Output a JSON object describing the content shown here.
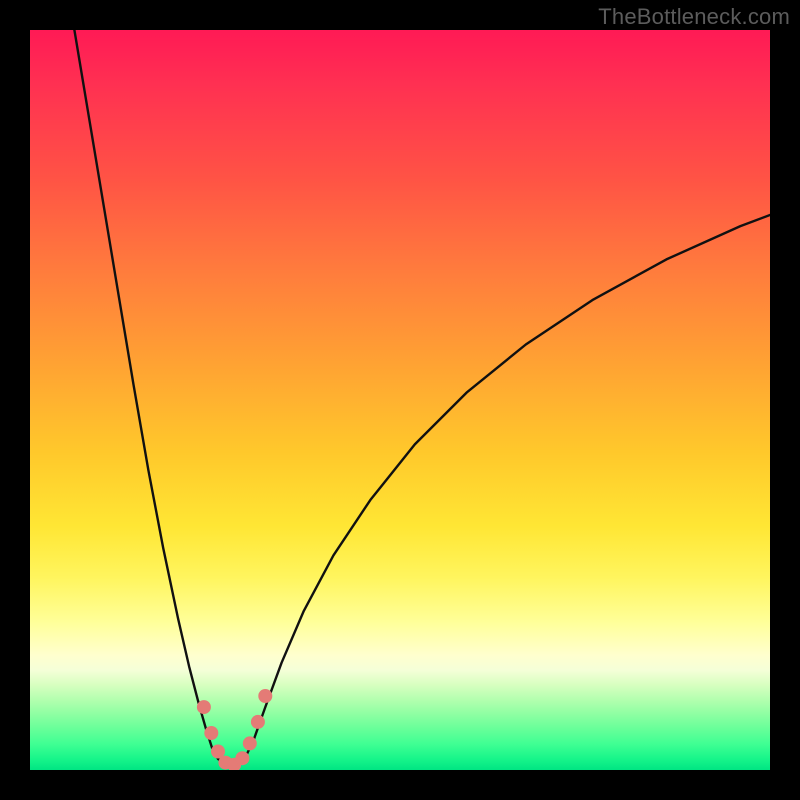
{
  "watermark": "TheBottleneck.com",
  "colors": {
    "frame": "#000000",
    "curve_stroke": "#111111",
    "dot_fill": "#e47b76",
    "gradient_stops": [
      "#ff1a55",
      "#ff2f52",
      "#ff5345",
      "#ff7a3d",
      "#ffa233",
      "#ffc82b",
      "#ffe634",
      "#fff55e",
      "#ffff99",
      "#ffffce",
      "#f5ffd8",
      "#d7ffc0",
      "#b3ffaf",
      "#8dffa2",
      "#66ff99",
      "#3fff93",
      "#17f58a",
      "#00e583"
    ]
  },
  "chart_data": {
    "type": "line",
    "title": "",
    "xlabel": "",
    "ylabel": "",
    "xlim": [
      0,
      100
    ],
    "ylim": [
      0,
      100
    ],
    "note": "x is normalized horizontal position across the inner plot (0=left edge, 100=right edge); y is 100 at top (red) descending to 0 at bottom (green). Values read off pixel positions.",
    "series": [
      {
        "name": "left-branch",
        "x": [
          6.0,
          8.0,
          10.0,
          12.0,
          14.0,
          16.0,
          18.0,
          20.0,
          21.5,
          22.8,
          23.8,
          24.6,
          25.4
        ],
        "y": [
          100.0,
          88.0,
          76.0,
          64.0,
          52.0,
          40.5,
          30.0,
          20.5,
          14.0,
          9.0,
          5.5,
          3.0,
          1.5
        ]
      },
      {
        "name": "valley",
        "x": [
          25.4,
          26.6,
          27.8,
          29.0
        ],
        "y": [
          1.5,
          0.6,
          0.6,
          1.5
        ]
      },
      {
        "name": "right-branch",
        "x": [
          29.0,
          30.2,
          31.8,
          34.0,
          37.0,
          41.0,
          46.0,
          52.0,
          59.0,
          67.0,
          76.0,
          86.0,
          96.0,
          100.0
        ],
        "y": [
          1.5,
          4.0,
          8.5,
          14.5,
          21.5,
          29.0,
          36.5,
          44.0,
          51.0,
          57.5,
          63.5,
          69.0,
          73.5,
          75.0
        ]
      }
    ],
    "dots": {
      "name": "valley-dots",
      "points": [
        {
          "x": 23.5,
          "y": 8.5
        },
        {
          "x": 24.5,
          "y": 5.0
        },
        {
          "x": 25.4,
          "y": 2.5
        },
        {
          "x": 26.4,
          "y": 1.0
        },
        {
          "x": 27.6,
          "y": 0.7
        },
        {
          "x": 28.7,
          "y": 1.6
        },
        {
          "x": 29.7,
          "y": 3.6
        },
        {
          "x": 30.8,
          "y": 6.5
        },
        {
          "x": 31.8,
          "y": 10.0
        }
      ],
      "radius": 7
    }
  }
}
